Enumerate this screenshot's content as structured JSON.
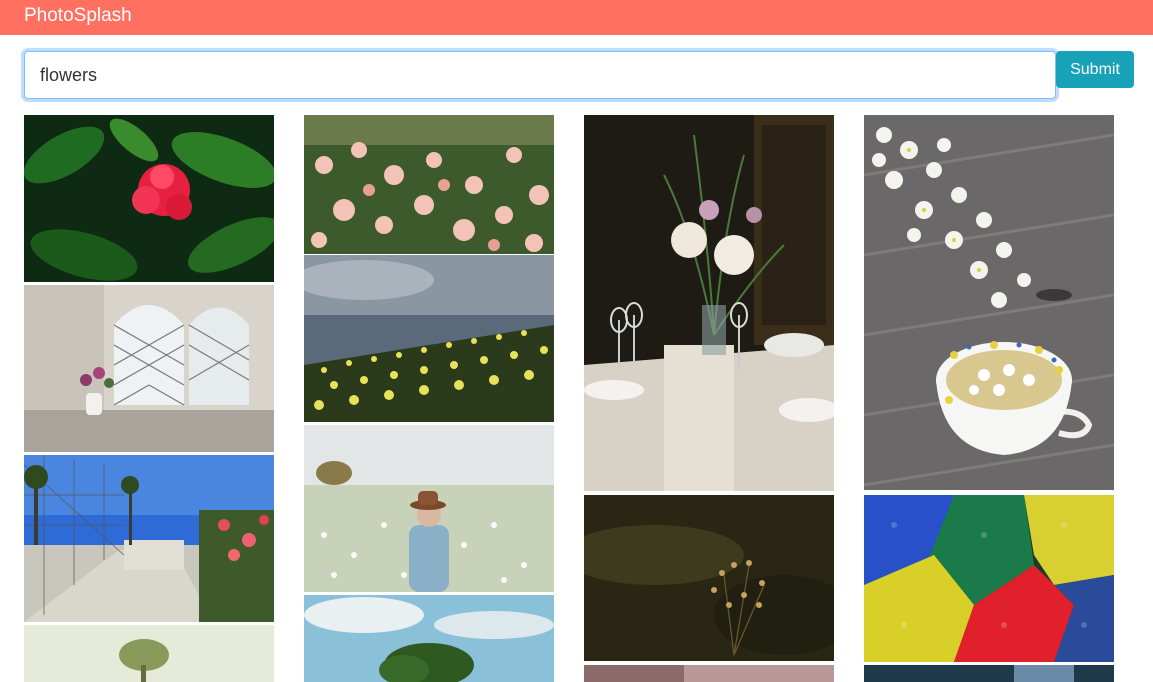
{
  "app": {
    "title": "PhotoSplash"
  },
  "search": {
    "value": "flowers",
    "submit_label": "Submit"
  },
  "colors": {
    "navbar": "#ff7060",
    "submit": "#17a2b8",
    "focus_ring": "#80bdff"
  },
  "grid": {
    "columns": [
      [
        "red-flower-leaves",
        "window-vase",
        "fence-path",
        "tree-field"
      ],
      [
        "pink-flower-bush",
        "tulip-field",
        "hat-meadow",
        "trees-sky"
      ],
      [
        "dinner-table",
        "dark-dry-flowers",
        "bottom-photo-3"
      ],
      [
        "white-flowers-teacup",
        "colorful-flowers",
        "bottom-photo-4"
      ]
    ]
  }
}
